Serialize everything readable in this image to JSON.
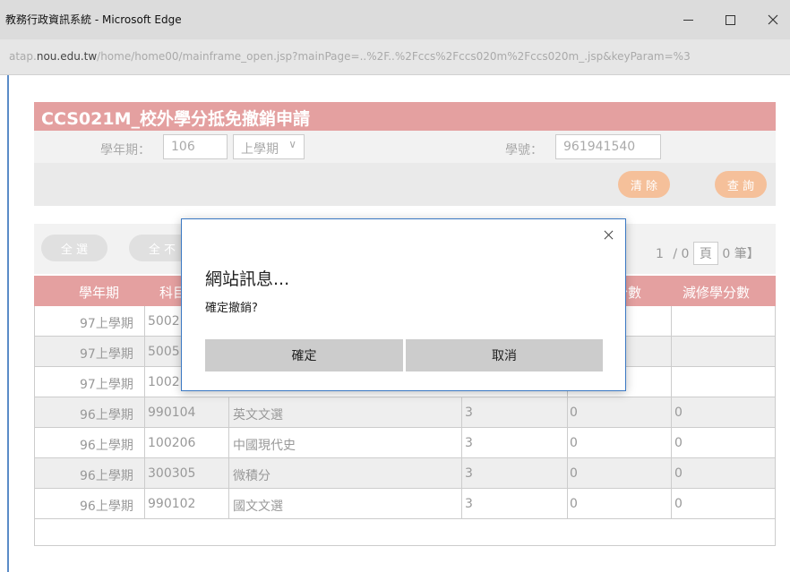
{
  "window": {
    "title": "教務行政資訊系統 - Microsoft Edge",
    "url_prefix": "atap.",
    "url_domain": "nou.edu.tw",
    "url_rest": "/home/home00/mainframe_open.jsp?mainPage=..%2F..%2Fccs%2Fccs020m%2Fccs020m_.jsp&keyParam=%3"
  },
  "page": {
    "title": "CCS021M_校外學分抵免撤銷申請",
    "form": {
      "year_label": "學年期：",
      "year_value": "106",
      "term_value": "上學期",
      "student_id_label": "學號：",
      "student_id_value": "961941540"
    },
    "buttons": {
      "clear": "清 除",
      "query": "查 詢",
      "select_all": "全 選",
      "deselect_all": "全 不"
    },
    "pager": {
      "current": "1",
      "sep": "/",
      "total_pages": "0",
      "page_unit": "頁",
      "count_text": "0 筆】"
    },
    "table": {
      "headers": [
        "學年期",
        "科目",
        "分數",
        "減修學分數"
      ],
      "rows": [
        {
          "term": "97上學期",
          "code": "5002",
          "name": "",
          "credits": "",
          "score": "",
          "reduce": ""
        },
        {
          "term": "97上學期",
          "code": "5005",
          "name": "",
          "credits": "",
          "score": "",
          "reduce": ""
        },
        {
          "term": "97上學期",
          "code": "1002",
          "name": "",
          "credits": "",
          "score": "",
          "reduce": ""
        },
        {
          "term": "96上學期",
          "code": "990104",
          "name": "英文文選",
          "credits": "3",
          "score": "0",
          "reduce": "0"
        },
        {
          "term": "96上學期",
          "code": "100206",
          "name": "中國現代史",
          "credits": "3",
          "score": "0",
          "reduce": "0"
        },
        {
          "term": "96上學期",
          "code": "300305",
          "name": "微積分",
          "credits": "3",
          "score": "0",
          "reduce": "0"
        },
        {
          "term": "96上學期",
          "code": "990102",
          "name": "國文文選",
          "credits": "3",
          "score": "0",
          "reduce": "0"
        }
      ]
    }
  },
  "dialog": {
    "title": "網站訊息...",
    "message": "確定撤銷?",
    "ok": "確定",
    "cancel": "取消"
  },
  "colors": {
    "header_bg": "#e4a0a0",
    "orange_button": "#f5c09a",
    "dialog_border": "#3a78c3"
  }
}
